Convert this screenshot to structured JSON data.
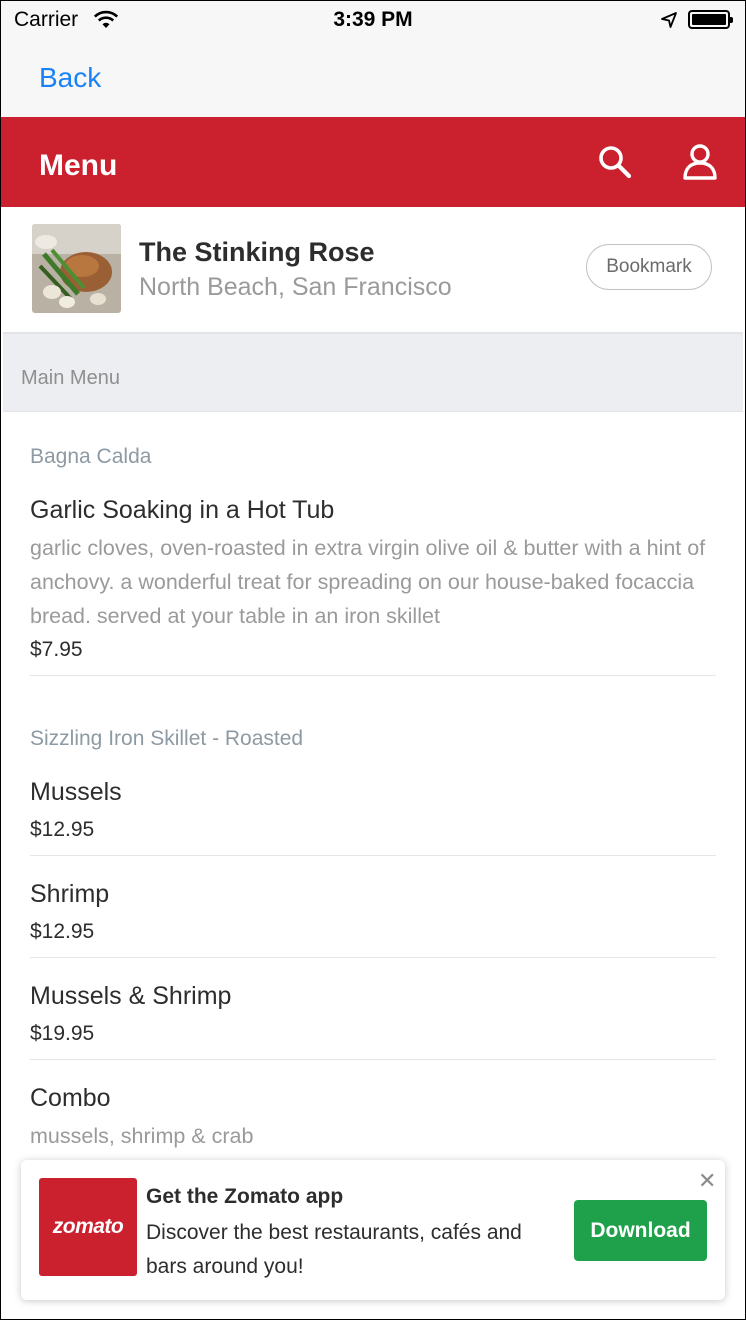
{
  "status_bar": {
    "carrier": "Carrier",
    "time": "3:39 PM"
  },
  "nav": {
    "back_label": "Back"
  },
  "header": {
    "title": "Menu",
    "accent_color": "#cb202d",
    "icons": [
      "search-icon",
      "user-icon"
    ]
  },
  "restaurant": {
    "name": "The Stinking Rose",
    "location": "North Beach, San Francisco",
    "bookmark_label": "Bookmark"
  },
  "section": {
    "label": "Main Menu"
  },
  "menu": {
    "categories": [
      {
        "name": "Bagna Calda",
        "items": [
          {
            "name": "Garlic Soaking in a Hot Tub",
            "description": "garlic cloves, oven-roasted in extra virgin olive oil & butter with a hint of anchovy. a wonderful treat for spreading on our house-baked focaccia bread. served at your table in an iron skillet",
            "price": "$7.95"
          }
        ]
      },
      {
        "name": "Sizzling Iron Skillet - Roasted",
        "items": [
          {
            "name": "Mussels",
            "price": "$12.95"
          },
          {
            "name": "Shrimp",
            "price": "$12.95"
          },
          {
            "name": "Mussels & Shrimp",
            "price": "$19.95"
          },
          {
            "name": "Combo",
            "description": "mussels, shrimp & crab"
          }
        ]
      }
    ]
  },
  "promo": {
    "logo_text": "zomato",
    "title": "Get the Zomato app",
    "text": "Discover the best restaurants, cafés and bars around you!",
    "download_label": "Download",
    "close_symbol": "✕",
    "button_color": "#1fa04a"
  }
}
